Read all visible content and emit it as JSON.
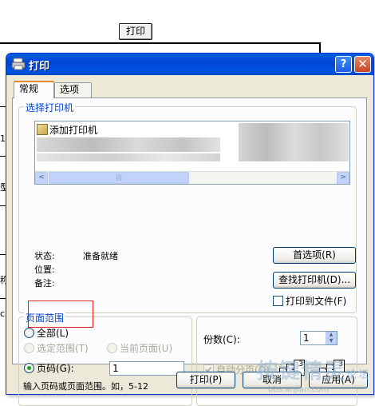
{
  "background_page": {
    "print_button_label": "打印",
    "side_chars": [
      "1",
      "型",
      "称",
      "c3"
    ],
    "watermark": "按键精灵",
    "watermark_suffix": "论坛",
    "watermark_url": "bbs.anjian.com"
  },
  "dialog": {
    "title": "打印",
    "help_label": "?",
    "close_label": "✕",
    "tabs": [
      {
        "label": "常规",
        "active": true
      },
      {
        "label": "选项",
        "active": false
      }
    ],
    "select_printer": {
      "legend": "选择打印机",
      "items": [
        {
          "label": "添加打印机",
          "icon": "add-printer-icon"
        }
      ],
      "scroll_left": "<",
      "scroll_right": ">",
      "scroll_grip": "|||"
    },
    "status": {
      "status_label": "状态:",
      "status_value": "准备就绪",
      "location_label": "位置:",
      "location_value": "",
      "comment_label": "备注:",
      "comment_value": ""
    },
    "buttons": {
      "preferences": "首选项(R)",
      "find_printer": "查找打印机(D)...",
      "print": "打印(P)",
      "cancel": "取消",
      "apply": "应用(A)"
    },
    "print_to_file": {
      "label": "打印到文件(F)",
      "checked": false
    },
    "page_range": {
      "legend": "页面范围",
      "all": {
        "label": "全部(L)",
        "checked": false
      },
      "selection": {
        "label": "选定范围(T)",
        "enabled": false
      },
      "current_page": {
        "label": "当前页面(U)",
        "enabled": false
      },
      "pages": {
        "label": "页码(G):",
        "checked": true,
        "value": "1"
      },
      "hint": "输入页码或页面范围。如，5-12"
    },
    "copies": {
      "label": "份数(C):",
      "value": "1",
      "collate": {
        "label": "自动分页(O)",
        "checked": true,
        "enabled": false
      },
      "collate_pages": [
        "1",
        "2",
        "3"
      ]
    }
  }
}
